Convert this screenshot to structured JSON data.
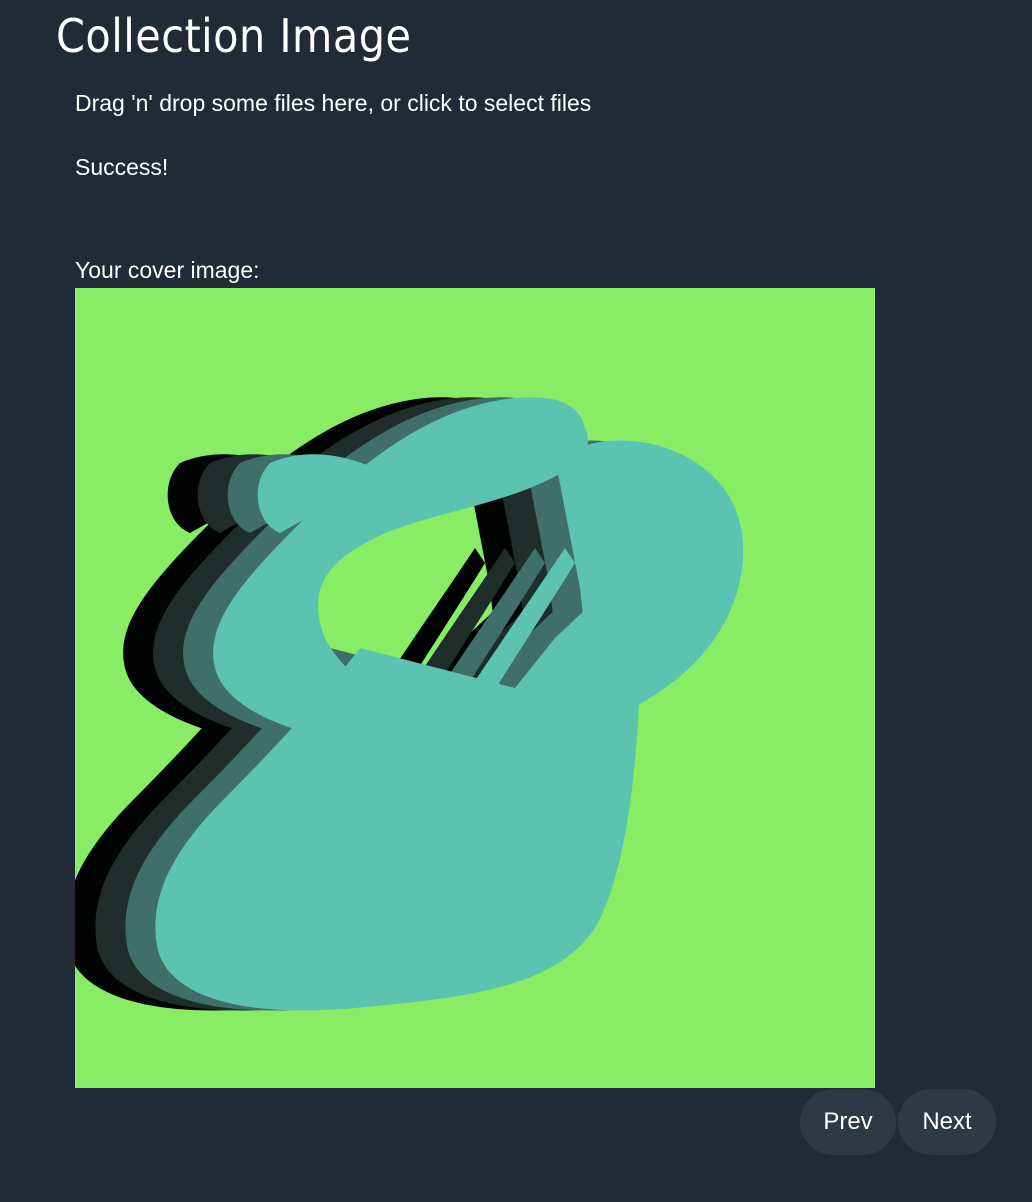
{
  "page": {
    "title": "Collection Image"
  },
  "dropzone": {
    "instructions": "Drag 'n' drop some files here, or click to select files"
  },
  "upload": {
    "status": "Success!"
  },
  "cover": {
    "label": "Your cover image:",
    "colors": {
      "background": "#88ec64",
      "shadow_1": "#020403",
      "shadow_2": "#1f2d2b",
      "shadow_3": "#3f6f68",
      "shape": "#5dc3b1"
    }
  },
  "navigation": {
    "prev_label": "Prev",
    "next_label": "Next"
  },
  "theme": {
    "page_background": "#212a36",
    "button_background": "#2f3845",
    "text_color": "#ffffff"
  }
}
